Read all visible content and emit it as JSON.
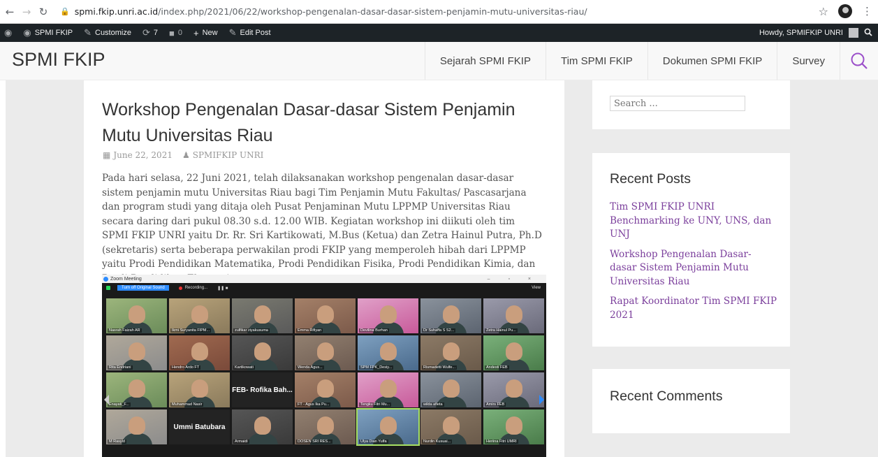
{
  "browser": {
    "url_domain": "spmi.fkip.unri.ac.id",
    "url_path": "/index.php/2021/06/22/workshop-pengenalan-dasar-dasar-sistem-penjamin-mutu-universitas-riau/"
  },
  "adminbar": {
    "site": "SPMI FKIP",
    "customize": "Customize",
    "updates_count": "7",
    "comments_count": "0",
    "new": "New",
    "edit_post": "Edit Post",
    "howdy": "Howdy, SPMIFKIP UNRI"
  },
  "site": {
    "title": "SPMI FKIP"
  },
  "nav": {
    "items": [
      "Sejarah SPMI FKIP",
      "Tim SPMI FKIP",
      "Dokumen SPMI FKIP",
      "Survey"
    ]
  },
  "post": {
    "title": "Workshop Pengenalan Dasar-dasar Sistem Penjamin Mutu Universitas Riau",
    "date": "June 22, 2021",
    "author": "SPMIFKIP UNRI",
    "body": "Pada hari selasa, 22 Juni 2021, telah dilaksanakan workshop pengenalan dasar-dasar sistem penjamin mutu Universitas Riau bagi Tim Penjamin Mutu Fakultas/ Pascasarjana dan program studi yang ditaja oleh Pusat Penjaminan Mutu LPPMP Universitas Riau secara daring dari pukul 08.30 s.d. 12.00 WIB. Kegiatan workshop ini diikuti oleh tim SPMI FKIP UNRI yaitu Dr. Rr. Sri Kartikowati, M.Bus (Ketua) dan Zetra Hainul Putra, Ph.D (sekretaris) serta beberapa perwakilan prodi FKIP yang memperoleh hibah dari LPPMP yaitu Prodi Pendidikan Matematika, Prodi Pendidikan Fisika, Prodi Pendidikan Kimia, dan Prodi Pendidikan Ekonomi."
  },
  "zoom": {
    "window_title": "Zoom Meeting",
    "button": "Turn off Original Sound",
    "recording": "Recording...",
    "view": "View",
    "tiles": [
      {
        "name": "Nasrah Faizah AR",
        "type": "photo"
      },
      {
        "name": "Ikmi Suryanita FIPM...",
        "type": "photo"
      },
      {
        "name": "zulfikar ziyakusuma",
        "type": "video"
      },
      {
        "name": "Emma Rifiyan",
        "type": "video"
      },
      {
        "name": "Devilina Burhan",
        "type": "video"
      },
      {
        "name": "Dr Suhaffa S S2...",
        "type": "video"
      },
      {
        "name": "Zetra Hainul Pu...",
        "type": "video"
      },
      {
        "name": "Rita Endriani",
        "type": "photo"
      },
      {
        "name": "Hendro Ardo FT",
        "type": "photo"
      },
      {
        "name": "Kartikowati",
        "type": "video"
      },
      {
        "name": "Wenda Agus...",
        "type": "video"
      },
      {
        "name": "SPM FPK_Desiy...",
        "type": "video"
      },
      {
        "name": "Rismadetti Wulfe...",
        "type": "video"
      },
      {
        "name": "Andesti FEB",
        "type": "video"
      },
      {
        "name": "Enayati_F...",
        "type": "video"
      },
      {
        "name": "Muhammad Nasir",
        "type": "photo"
      },
      {
        "name": "FEB- Rofika Bah...",
        "type": "text"
      },
      {
        "name": "FT - Agus Ika Pu...",
        "type": "video"
      },
      {
        "name": "Tengku Fitri Mu...",
        "type": "video"
      },
      {
        "name": "wilda afieta",
        "type": "video"
      },
      {
        "name": "Amirs FEB",
        "type": "video"
      },
      {
        "name": "M Rasyid",
        "type": "video"
      },
      {
        "name": "Ummi Batubara",
        "type": "text"
      },
      {
        "name": "Armaidi",
        "type": "video"
      },
      {
        "name": "DOSEN SRI RES...",
        "type": "video"
      },
      {
        "name": "Ulya Dian Yulfa",
        "type": "video"
      },
      {
        "name": "Nurdin Kusuai...",
        "type": "video"
      },
      {
        "name": "Heriina Fitri UMRI",
        "type": "video"
      }
    ]
  },
  "sidebar": {
    "search_placeholder": "Search ...",
    "recent_posts_title": "Recent Posts",
    "recent_posts": [
      "Tim SPMI FKIP UNRI Benchmarking ke UNY, UNS, dan UNJ",
      "Workshop Pengenalan Dasar-dasar Sistem Penjamin Mutu Universitas Riau",
      "Rapat Koordinator Tim SPMI FKIP 2021"
    ],
    "recent_comments_title": "Recent Comments"
  },
  "colors": {
    "adminbar_bg": "#1d2327",
    "link": "#7b3f9c",
    "search_icon": "#9b4fc9",
    "zoom_accent": "#2d8cff"
  }
}
